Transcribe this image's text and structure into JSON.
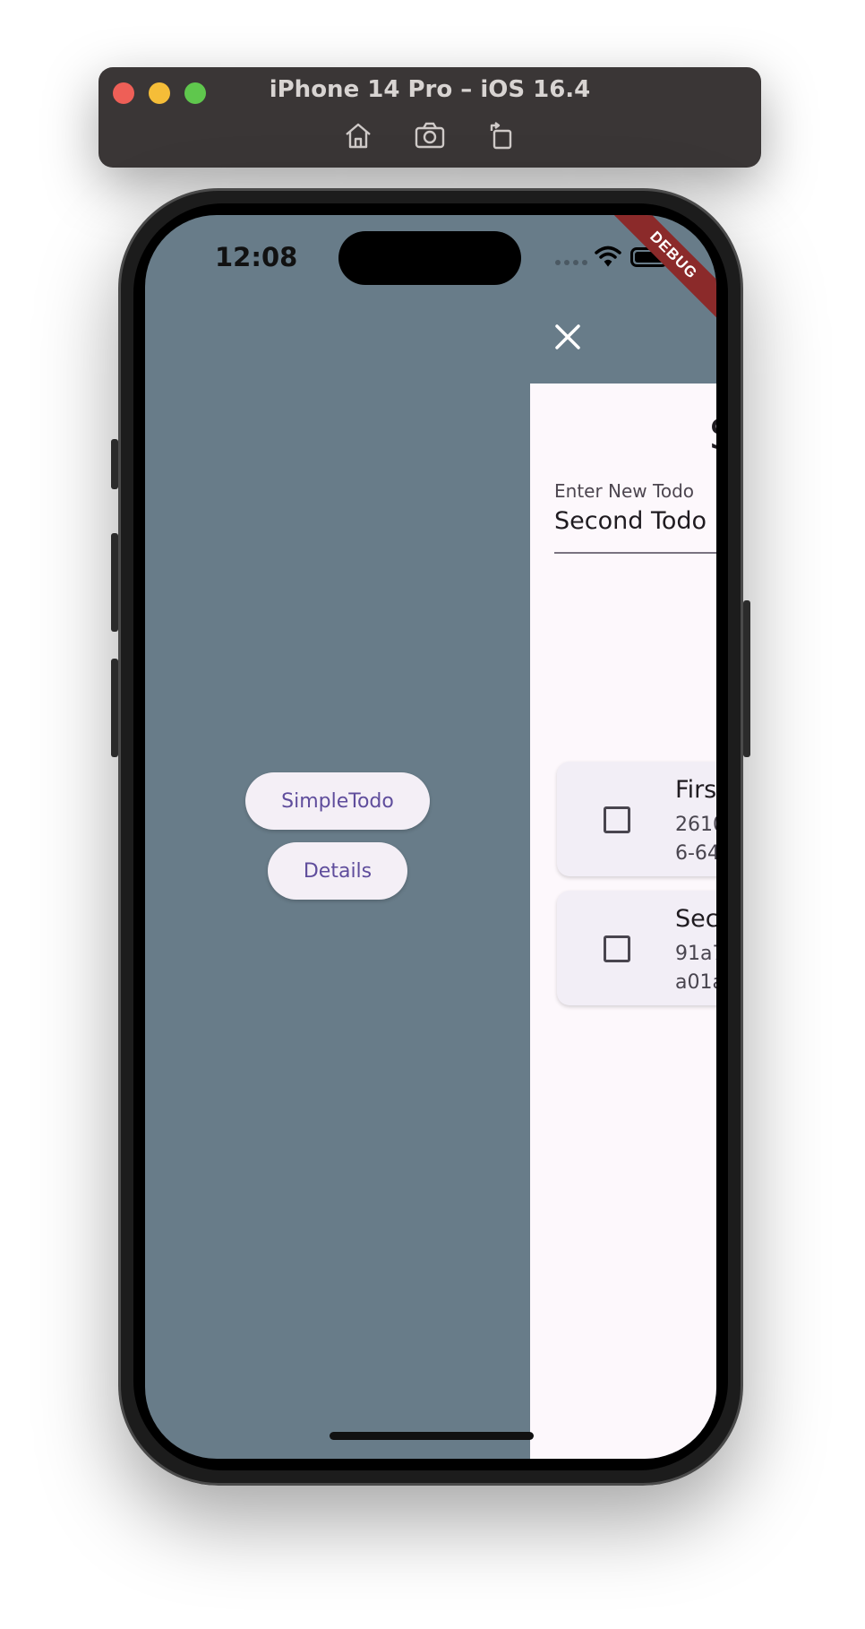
{
  "simulator": {
    "title": "iPhone 14 Pro – iOS 16.4",
    "toolbar": [
      "home-icon",
      "screenshot-icon",
      "rotate-icon"
    ]
  },
  "status_bar": {
    "time": "12:08",
    "debug_label": "DEBUG"
  },
  "drawer": {
    "buttons": [
      "SimpleTodo",
      "Details"
    ],
    "close_icon": "close-icon"
  },
  "main": {
    "title_fragment": "S",
    "input": {
      "label": "Enter New Todo",
      "value": "Second Todo"
    },
    "todos": [
      {
        "title": "Firs",
        "id_line1": "2610",
        "id_line2": "6-64",
        "checked": false
      },
      {
        "title": "Sec",
        "id_line1": "91a7",
        "id_line2": "a01a",
        "checked": false
      }
    ]
  },
  "colors": {
    "drawer_bg": "#687c89",
    "panel_bg": "#fdf8fc",
    "button_text": "#5f4d9c",
    "debug_ribbon": "#8b2a2a"
  }
}
